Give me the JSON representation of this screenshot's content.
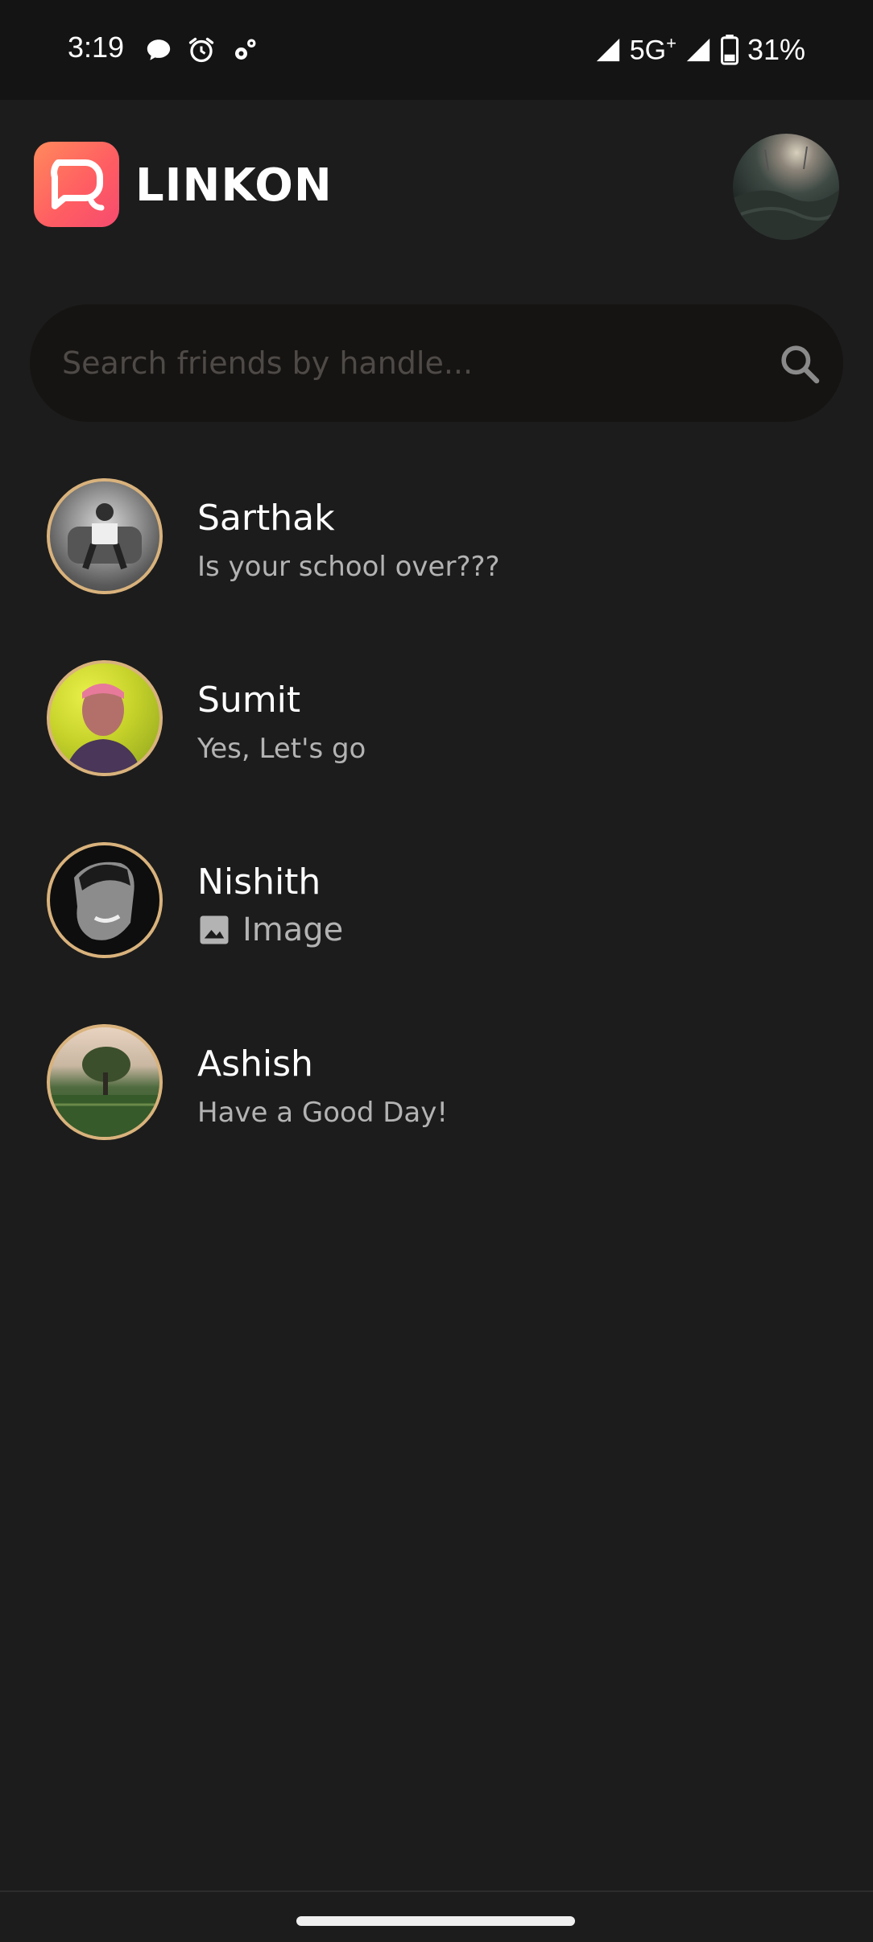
{
  "status_bar": {
    "time": "3:19",
    "network": "5G",
    "network_plus": "+",
    "battery": "31%",
    "icons_left": [
      "chat-bubble-icon",
      "alarm-icon",
      "settings-gear-icon"
    ],
    "icons_right": [
      "signal-icon",
      "signal-icon",
      "battery-icon"
    ]
  },
  "header": {
    "title": "LINKON",
    "logo_icon": "chat-bubbles-logo-icon",
    "profile_icon": "profile-avatar"
  },
  "search": {
    "placeholder": "Search friends by handle...",
    "value": "",
    "icon": "search-icon"
  },
  "chats": [
    {
      "name": "Sarthak",
      "preview": "Is your school over???"
    },
    {
      "name": "Sumit",
      "preview": "Yes, Let's go"
    },
    {
      "name": "Nishith",
      "preview": "Image",
      "preview_icon": "image-icon"
    },
    {
      "name": "Ashish",
      "preview": "Have a Good Day!"
    }
  ],
  "colors": {
    "background": "#1c1c1c",
    "status_bar": "#141414",
    "search_bg": "#161412",
    "avatar_ring": "#d9b27c",
    "accent_gradient_start": "#ff8a5c",
    "accent_gradient_end": "#f64b6f",
    "preview_text": "#b3b3b3"
  }
}
